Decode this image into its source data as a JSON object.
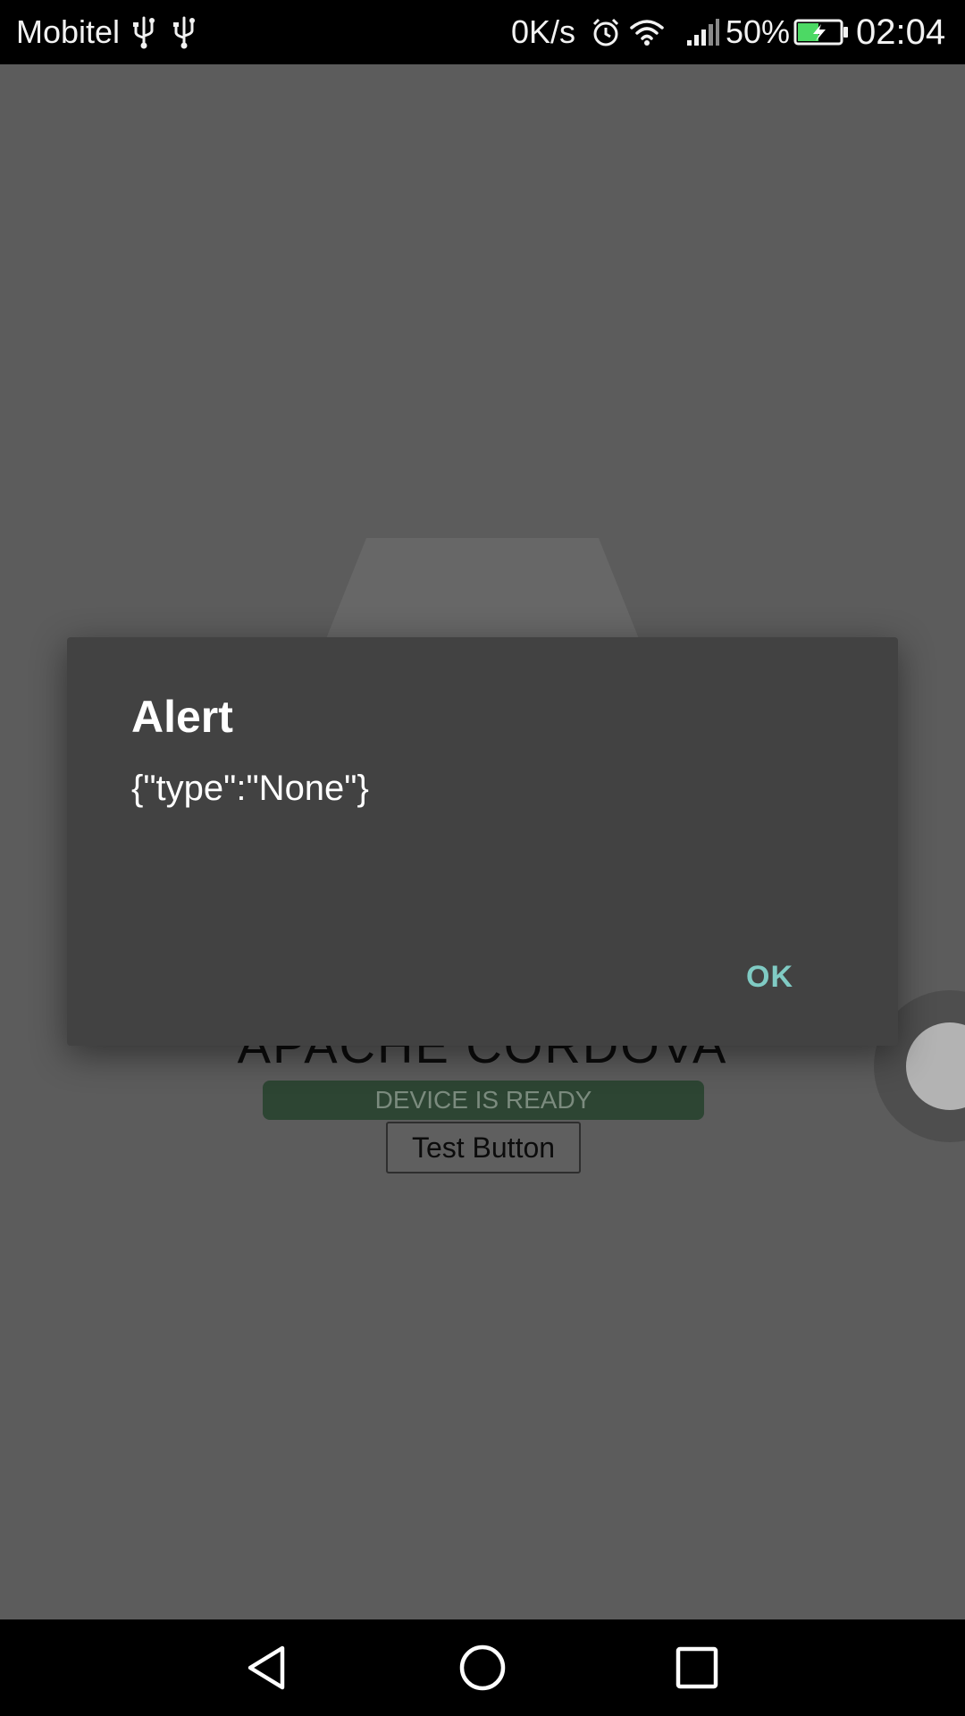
{
  "status_bar": {
    "carrier": "Mobitel",
    "net_speed": "0K/s",
    "battery_percent": "50%",
    "time": "02:04",
    "battery_level": 0.5,
    "icons": [
      "usb-icon",
      "usb-icon",
      "alarm-icon",
      "wifi-icon",
      "signal-icon",
      "battery-charging-icon"
    ]
  },
  "app": {
    "heading": "APACHE CORDOVA",
    "device_status": "DEVICE IS READY",
    "test_button_label": "Test Button"
  },
  "dialog": {
    "title": "Alert",
    "message": "{\"type\":\"None\"}",
    "ok_label": "OK"
  },
  "nav_bar": {
    "icons": [
      "back-icon",
      "home-icon",
      "recents-icon"
    ]
  },
  "colors": {
    "dialog_background": "#424242",
    "dialog_button": "#80cbc4",
    "scrim_app_background": "#5c5c5c",
    "device_ready_background": "#2d4533",
    "battery_fill": "#4cd964"
  }
}
